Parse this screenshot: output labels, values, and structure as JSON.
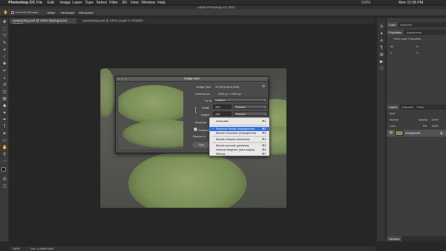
{
  "menubar": {
    "app_name": "Photoshop CC",
    "items": [
      "File",
      "Edit",
      "Image",
      "Layer",
      "Type",
      "Select",
      "Filter",
      "3D",
      "View",
      "Window",
      "Help"
    ],
    "window_title": "Adobe Photoshop CC 2017",
    "battery": "100%",
    "clock": "Mon 11:56 PM"
  },
  "options": {
    "scroll_all": "Scroll All Windows",
    "zoom": "100%",
    "fit_screen": "Fit Screen",
    "fill_screen": "Fill Screen"
  },
  "tabs": [
    "Upsampling.psd @ 100% (Background, RGB/8)",
    "Upsampling.psd @ 100% (Layer 0, RGB/8) *"
  ],
  "dialog": {
    "title": "Image Size",
    "image_size_label": "Image Size:",
    "image_size_value": "22.0M (was 5.49M)",
    "dimensions_label": "Dimensions:",
    "dimensions_value": "3200 px × 2400 px",
    "fit_to_label": "Fit To:",
    "fit_to_value": "Custom",
    "width_label": "Width:",
    "width_value": "200",
    "width_unit": "Percent",
    "height_label": "Height:",
    "height_value": "200",
    "height_unit": "Percent",
    "resolution_label": "Resolutio",
    "resample_label": "Resamp",
    "reduce_noise_label": "Reduce N",
    "cancel_label": "Can"
  },
  "resample_menu": [
    {
      "label": "Automatic",
      "shortcut": "⌘1",
      "selected": false
    },
    {
      "label": "Preserve Details (enlargement)",
      "shortcut": "⌘2",
      "selected": true
    },
    {
      "label": "Bicubic Smoother (enlargement)",
      "shortcut": "⌘3",
      "selected": false
    },
    {
      "label": "Bicubic Sharper (reduction)",
      "shortcut": "⌘4",
      "selected": false
    },
    {
      "label": "Bicubic (smooth gradients)",
      "shortcut": "⌘5",
      "selected": false
    },
    {
      "label": "Nearest Neighbor (hard edges)",
      "shortcut": "⌘6",
      "selected": false
    },
    {
      "label": "Bilinear",
      "shortcut": "⌘7",
      "selected": false
    }
  ],
  "right_panel": {
    "tabs_top": [
      "Color",
      "Swatches"
    ],
    "tabs_props": [
      "Properties",
      "Adjustments"
    ],
    "props_subtitle": "Pixel Layer Properties",
    "props_labels": [
      "W:",
      "H:",
      "X:",
      "Y:"
    ],
    "tabs_layers": [
      "Layers",
      "Channels",
      "Paths"
    ],
    "kind_label": "Kind",
    "blend_mode": "Normal",
    "opacity_label": "Opacity:",
    "opacity_value": "100%",
    "lock_label": "Lock:",
    "fill_label": "Fill:",
    "fill_value": "100%",
    "layer_name": "Background",
    "libraries_label": "Libraries"
  },
  "status": {
    "zoom": "100%",
    "doc": "Doc: 5.49M/5.49M"
  },
  "colors": {
    "highlight": "#2f6fe0",
    "ui_dark": "#282828"
  }
}
